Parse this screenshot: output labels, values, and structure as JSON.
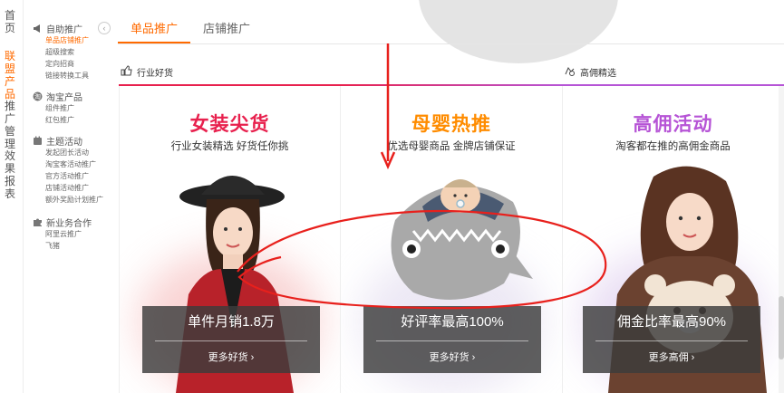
{
  "colors": {
    "accent": "#ff6a00",
    "card1_title": "#e8214e",
    "card2_title": "#ff8c00",
    "card3_title": "#b654d6",
    "annotation": "#e8201c"
  },
  "vnav": [
    {
      "label": "首页"
    },
    {
      "label": "联盟产品"
    },
    {
      "label": "推广管理"
    },
    {
      "label": "效果报表"
    }
  ],
  "sidebar": {
    "groups": [
      {
        "title": "自助推广",
        "icon": "megaphone-icon",
        "items": [
          "单品店铺推广",
          "超级搜索",
          "定向招商",
          "链接转换工具"
        ]
      },
      {
        "title": "淘宝产品",
        "icon": "taobao-icon",
        "items": [
          "组件推广",
          "红包推广"
        ]
      },
      {
        "title": "主题活动",
        "icon": "theme-icon",
        "items": [
          "发起团长活动",
          "淘宝客活动推广",
          "官方活动推广",
          "店铺活动推广",
          "额外奖励计划推广"
        ]
      },
      {
        "title": "新业务合作",
        "icon": "puzzle-icon",
        "items": [
          "阿里云推广",
          "飞猪"
        ]
      }
    ],
    "collapse_glyph": "‹"
  },
  "tabs": [
    {
      "label": "单品推广"
    },
    {
      "label": "店铺推广"
    }
  ],
  "categories": [
    {
      "label": "行业好货",
      "icon": "thumb-icon"
    },
    {
      "label": "高佣精选",
      "icon": "coin-icon"
    }
  ],
  "cards": [
    {
      "title": "女装尖货",
      "subtitle": "行业女装精选 好货任你挑",
      "stat": "单件月销1.8万",
      "more": "更多好货 ›"
    },
    {
      "title": "母婴热推",
      "subtitle": "优选母婴商品 金牌店铺保证",
      "stat": "好评率最高100%",
      "more": "更多好货 ›"
    },
    {
      "title": "高佣活动",
      "subtitle": "淘客都在推的高佣金商品",
      "stat": "佣金比率最高90%",
      "more": "更多高佣 ›"
    }
  ]
}
